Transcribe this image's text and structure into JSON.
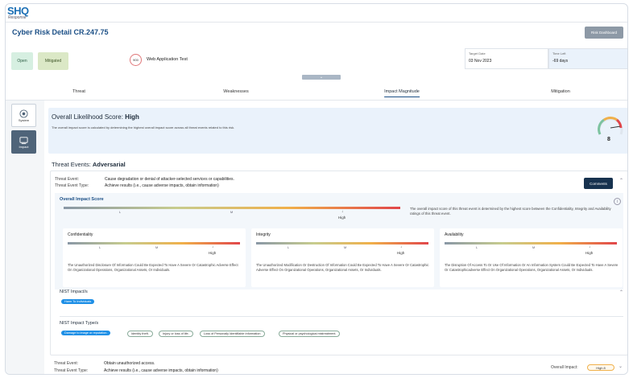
{
  "app": {
    "logo_main": "SHQ",
    "logo_sub": "Response"
  },
  "header": {
    "title": "Cyber Risk Detail CR.247.75",
    "dashboard_button": "Risk Dashboard"
  },
  "status": {
    "open": "Open",
    "mitigated": "Mitigated",
    "score": "900",
    "scenario": "Web Application Test"
  },
  "dates": {
    "target_label": "Target Date",
    "target_value": "03 Nov 2023",
    "time_left_label": "Time Left",
    "time_left_value": "-69 days"
  },
  "collapse_icon": "chevron-down-icon",
  "tabs": [
    {
      "label": "Threat"
    },
    {
      "label": "Weaknesses"
    },
    {
      "label": "Impact Magnitude"
    },
    {
      "label": "Mitigation"
    }
  ],
  "sidebar": {
    "system": "System",
    "impact": "Impact"
  },
  "likelihood": {
    "label": "Overall Likelihood Score:",
    "value": "High",
    "description": "The overall impact score is calculated by determining the highest overall impact score across all threat events related to this risk.",
    "gauge_value": "8",
    "gauge_fraction": 0.8
  },
  "threat_events": {
    "label": "Threat Events:",
    "value": "Adversarial"
  },
  "event1": {
    "event_label": "Threat Event:",
    "event_value": "Cause degradation or denial of attacker-selected services or capabilities.",
    "type_label": "Threat Event Type:",
    "type_value": "Achieve results (i.e., cause adverse impacts, obtain information)",
    "comments": "Comments",
    "overall_title": "Overall Impact Score",
    "overall_desc": "The overall impact score of this threat event is determined by the highest score between the Confidentiality, Integrity and Availability ratings of this threat event.",
    "scale": {
      "l": "L",
      "m": "M",
      "high": "High"
    },
    "cia": [
      {
        "title": "Confidentiality",
        "desc": "The Unauthorized Disclosure Of Information Could Be Expected To Have A Severe Or Catastrophic Adverse Effect On Organizational Operations, Organizational Assets, Or Individuals."
      },
      {
        "title": "Integrity",
        "desc": "The Unauthorized Modification Or Destruction Of Information Could Be Expected To Have A Severe Or Catastrophic Adverse Effect On Organizational Operations, Organizational Assets, Or Individuals."
      },
      {
        "title": "Availability",
        "desc": "The Disruption Of Access To Or Use Of Information Or An Information System Could Be Expected To Have A Severe Or Catastrophicadverse Effect On Organizational Operations, Organizational Assets, Or Individuals."
      }
    ],
    "nist_impact_title": "NIST Impact/s",
    "nist_impacts": [
      "Harm To Individuals"
    ],
    "nist_types_title": "NIST Impact Type/s",
    "nist_types": [
      "Damage to image or reputation.",
      "Identity theft.",
      "Injury or loss of life.",
      "Loss of Personally Identifiable Information",
      "Physical or psychological mistreatment."
    ]
  },
  "event2": {
    "event_label": "Threat Event:",
    "event_value": "Obtain unauthorized access.",
    "type_label": "Threat Event Type:",
    "type_value": "Achieve results (i.e., cause adverse impacts, obtain information)",
    "overall_label": "Overall Impact:",
    "overall_value": "High 8"
  },
  "colors": {
    "accent": "#1b4f86",
    "open_bg": "#d6efe1",
    "mitigated_bg": "#dbe8c6",
    "pill": "#1e8fe6",
    "dark_btn": "#17324f"
  }
}
